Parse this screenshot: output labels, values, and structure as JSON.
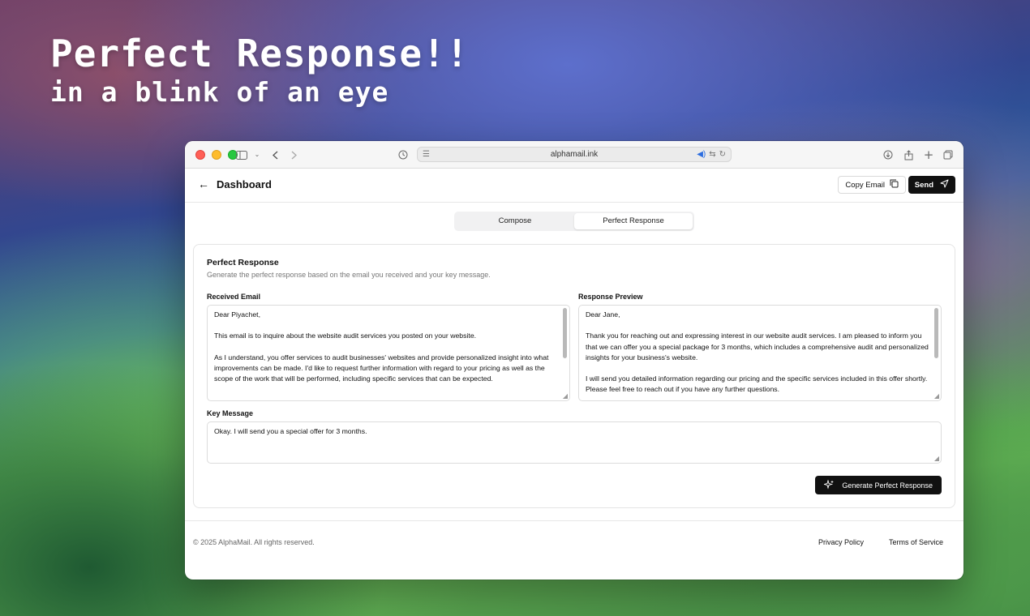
{
  "hero": {
    "line1": "Perfect Response!!",
    "line2": "in a blink of an eye"
  },
  "browser": {
    "url": "alphamail.ink",
    "icons": [
      "sidebar-icon",
      "chevron-down-icon",
      "back-icon",
      "forward-icon",
      "history-icon",
      "reader-icon",
      "audio-icon",
      "translate-icon",
      "reload-icon",
      "download-icon",
      "share-icon",
      "new-tab-icon",
      "tabs-overview-icon"
    ]
  },
  "header": {
    "title": "Dashboard",
    "copy_label": "Copy Email",
    "send_label": "Send"
  },
  "tabs": [
    {
      "label": "Compose",
      "active": false
    },
    {
      "label": "Perfect Response",
      "active": true
    }
  ],
  "card": {
    "title": "Perfect Response",
    "subtitle": "Generate the perfect response based on the email you received and your key message.",
    "received_label": "Received Email",
    "received_text": "Dear Piyachet,\n\nThis email is to inquire about the website audit services you posted on your website.\n\nAs I understand, you offer services to audit businesses' websites and provide personalized insight into what improvements can be made. I'd like to request further information with regard to your pricing as well as the scope of the work that will be performed, including specific services that can be expected.",
    "preview_label": "Response Preview",
    "preview_text": "Dear Jane,\n\nThank you for reaching out and expressing interest in our website audit services. I am pleased to inform you that we can offer you a special package for 3 months, which includes a comprehensive audit and personalized insights for your business's website.\n\nI will send you detailed information regarding our pricing and the specific services included in this offer shortly. Please feel free to reach out if you have any further questions.",
    "key_label": "Key Message",
    "key_text": "Okay. I will send you a special offer for 3 months.",
    "generate_label": "Generate Perfect Response"
  },
  "footer": {
    "copyright": "© 2025 AlphaMail. All rights reserved.",
    "privacy": "Privacy Policy",
    "terms": "Terms of Service"
  },
  "colors": {
    "primary_button": "#111111",
    "tl_red": "#ff5f57",
    "tl_yellow": "#febc2e",
    "tl_green": "#28c840"
  }
}
